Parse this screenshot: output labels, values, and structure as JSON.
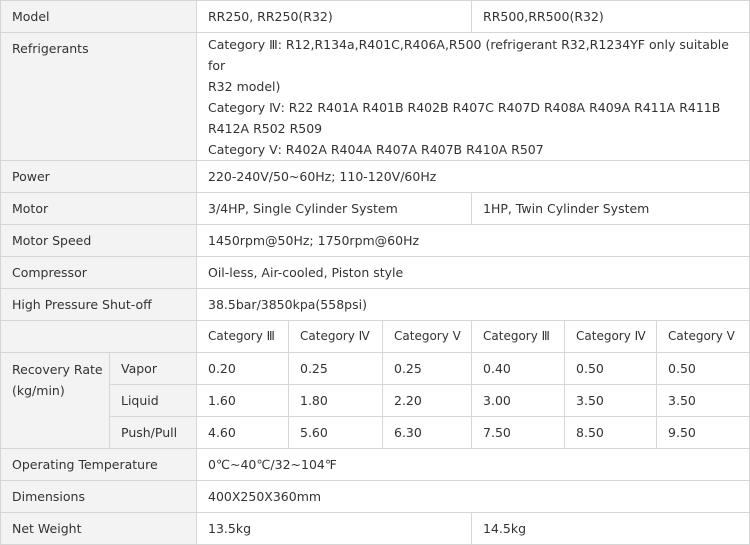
{
  "rows": {
    "model": {
      "label": "Model",
      "rr250": "RR250, RR250(R32)",
      "rr500": "RR500,RR500(R32)"
    },
    "refrigerants": {
      "label": "Refrigerants",
      "lines": [
        "Category Ⅲ: R12,R134a,R401C,R406A,R500 (refrigerant R32,R1234YF only suitable for",
        "R32 model)",
        "Category Ⅳ: R22 R401A R401B R402B R407C R407D R408A R409A R411A R411B",
        "R412A R502 R509",
        "Category Ⅴ: R402A R404A R407A R407B R410A R507"
      ]
    },
    "power": {
      "label": "Power",
      "value": "220-240V/50~60Hz; 110-120V/60Hz"
    },
    "motor": {
      "label": "Motor",
      "rr250": "3/4HP, Single Cylinder System",
      "rr500": "1HP, Twin Cylinder System"
    },
    "motor_speed": {
      "label": "Motor Speed",
      "value": "1450rpm@50Hz; 1750rpm@60Hz"
    },
    "compressor": {
      "label": "Compressor",
      "value": "Oil-less, Air-cooled, Piston style"
    },
    "high_pressure": {
      "label": "High Pressure Shut-off",
      "value": "38.5bar/3850kpa(558psi)"
    },
    "categories": [
      "Category Ⅲ",
      "Category Ⅳ",
      "Category Ⅴ",
      "Category Ⅲ",
      "Category Ⅳ",
      "Category Ⅴ"
    ],
    "recovery": {
      "label_line1": "Recovery Rate",
      "label_line2": "(kg/min)",
      "vapor": {
        "label": "Vapor",
        "values": [
          "0.20",
          "0.25",
          "0.25",
          "0.40",
          "0.50",
          "0.50"
        ]
      },
      "liquid": {
        "label": "Liquid",
        "values": [
          "1.60",
          "1.80",
          "2.20",
          "3.00",
          "3.50",
          "3.50"
        ]
      },
      "pushpull": {
        "label": "Push/Pull",
        "values": [
          "4.60",
          "5.60",
          "6.30",
          "7.50",
          "8.50",
          "9.50"
        ]
      }
    },
    "operating_temp": {
      "label": "Operating Temperature",
      "value": "0℃~40℃/32~104℉"
    },
    "dimensions": {
      "label": "Dimensions",
      "value": "400X250X360mm"
    },
    "net_weight": {
      "label": "Net Weight",
      "rr250": "13.5kg",
      "rr500": "14.5kg"
    }
  }
}
